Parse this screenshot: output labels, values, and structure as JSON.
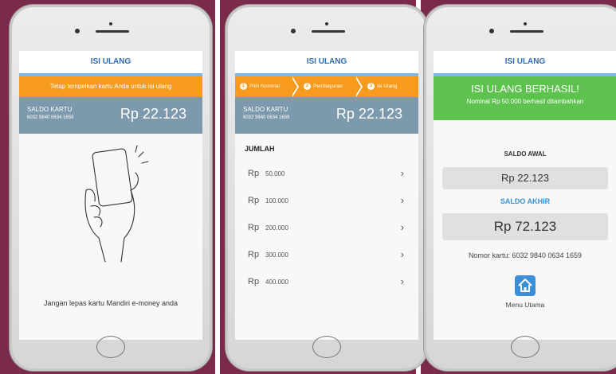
{
  "screens": {
    "tap": {
      "title": "ISI ULANG",
      "instruction": "Tetap tempelkan kartu Anda untuk isi ulang",
      "saldo_label": "SALDO KARTU",
      "card_number": "6032 9840 0634 1659",
      "saldo_amount": "Rp 22.123",
      "caption": "Jangan lepas kartu Mandiri e-money anda"
    },
    "select": {
      "title": "ISI ULANG",
      "steps": [
        {
          "num": "1",
          "label": "Pilih Nominal"
        },
        {
          "num": "2",
          "label": "Pembayaran"
        },
        {
          "num": "3",
          "label": "Isi Ulang"
        }
      ],
      "saldo_label": "SALDO KARTU",
      "card_number": "6032 9840 0634 1659",
      "saldo_amount": "Rp 22.123",
      "jumlah_label": "JUMLAH",
      "currency": "Rp",
      "options": [
        "50.000",
        "100.000",
        "200.000",
        "300.000",
        "400.000"
      ]
    },
    "success": {
      "title": "ISI ULANG",
      "headline": "ISI ULANG BERHASIL!",
      "subtitle": "Nominal Rp 50.000 berhasil ditambahkan",
      "saldo_awal_label": "SALDO AWAL",
      "saldo_awal": "Rp 22.123",
      "saldo_akhir_label": "SALDO AKHIR",
      "saldo_akhir": "Rp 72.123",
      "nomor_kartu": "Nomor kartu: 6032 9840 0634 1659",
      "menu_label": "Menu Utama"
    }
  },
  "colors": {
    "orange": "#f79b1c",
    "blue_header": "#2f6db3",
    "saldo_bg": "#7d99ad",
    "green": "#5ec24e",
    "home_blue": "#3b8fd8"
  }
}
